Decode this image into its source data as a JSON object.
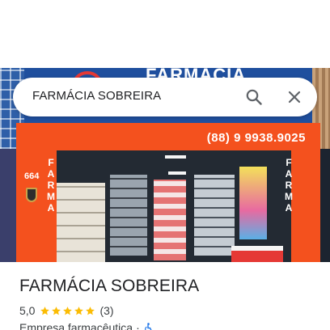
{
  "search": {
    "query": "FARMÁCIA SOBREIRA",
    "search_icon": "magnifier-icon",
    "clear_icon": "close-icon"
  },
  "photo": {
    "sign_text": "FARMÁCIA SOBREIRA",
    "phone": "(88) 9 9938.9025",
    "house_number": "664",
    "side_text": "FARMA"
  },
  "place": {
    "title": "FARMÁCIA SOBREIRA",
    "rating": "5,0",
    "stars": 5,
    "review_count": "(3)",
    "category": "Empresa farmacêutica",
    "separator": "·",
    "accessibility_icon": "wheelchair-icon"
  },
  "colors": {
    "star": "#fbbc04",
    "accessible": "#1a73e8",
    "frame_orange": "#f4511e",
    "sign_blue": "#1f4f9e"
  }
}
